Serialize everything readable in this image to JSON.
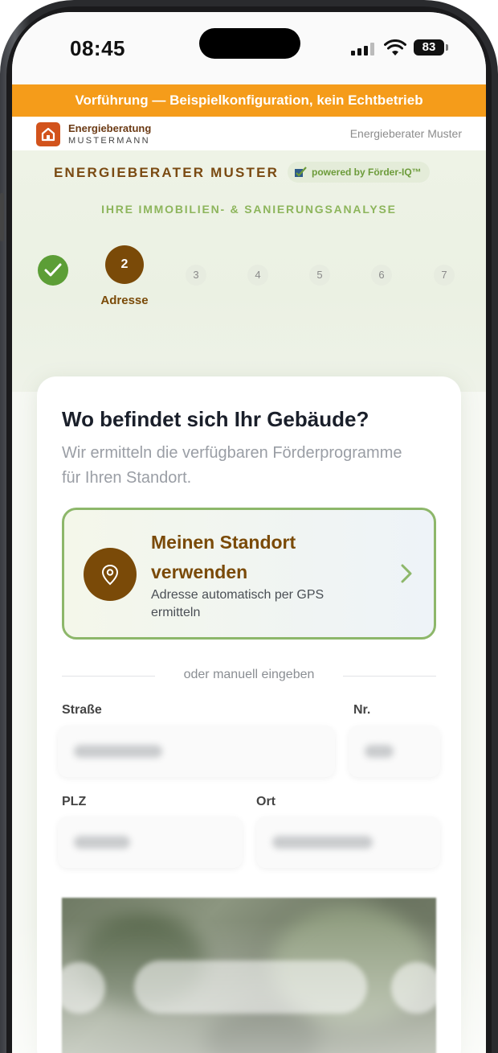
{
  "status_bar": {
    "time": "08:45",
    "battery": "83"
  },
  "banner": {
    "text": "Vorführung — Beispielkonfiguration, kein Echtbetrieb"
  },
  "brand": {
    "name": "Energieberatung",
    "subname": "MUSTERMANN",
    "right_label": "Energieberater Muster"
  },
  "hero": {
    "title": "ENERGIEBERATER MUSTER",
    "powered_by": "powered by Förder-IQ™",
    "subtitle": "IHRE IMMOBILIEN- & SANIERUNGSANALYSE"
  },
  "stepper": {
    "completed_steps": 1,
    "active": {
      "number": "2",
      "label": "Adresse"
    },
    "upcoming": [
      "3",
      "4",
      "5",
      "6",
      "7"
    ]
  },
  "card": {
    "title": "Wo befindet sich Ihr Gebäude?",
    "description": "Wir ermitteln die verfügbaren Förderprogramme für Ihren Standort.",
    "gps": {
      "title": "Meinen Standort verwenden",
      "description": "Adresse automatisch per GPS ermitteln"
    },
    "divider": "oder manuell eingeben",
    "fields": {
      "street_label": "Straße",
      "number_label": "Nr.",
      "zip_label": "PLZ",
      "city_label": "Ort"
    }
  },
  "colors": {
    "accent_brown": "#7a4a08",
    "accent_green": "#5c9e36",
    "banner_orange": "#f59c1a"
  },
  "icons": [
    "house-icon",
    "check-icon",
    "location-pin-icon",
    "chevron-right-icon",
    "wifi-icon",
    "signal-icon",
    "battery-icon"
  ]
}
